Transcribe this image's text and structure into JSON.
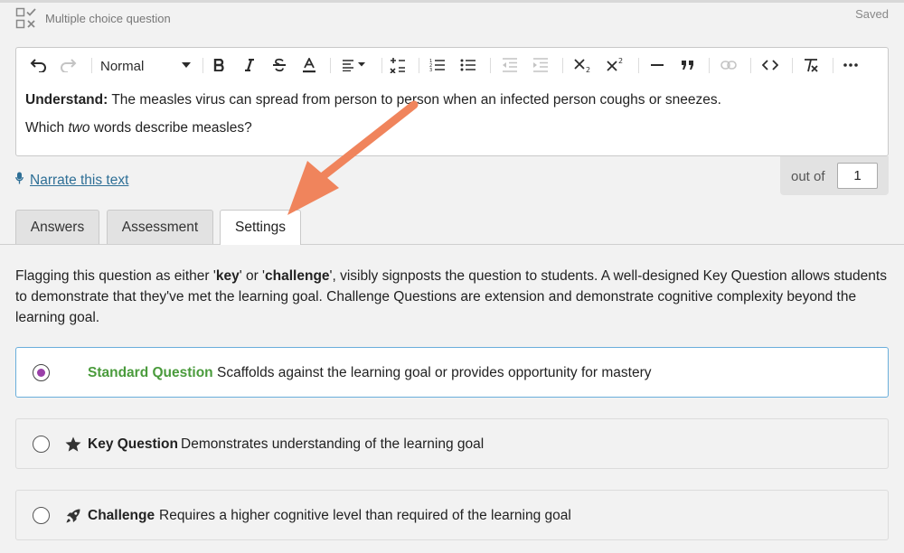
{
  "header": {
    "question_type": "Multiple choice question",
    "status": "Saved"
  },
  "editor": {
    "format_select_value": "Normal",
    "toolbar_icons": [
      "undo-icon",
      "redo-icon",
      "bold-icon",
      "italic-icon",
      "strikethrough-icon",
      "text-color-icon",
      "align-icon",
      "formula-icon",
      "ordered-list-icon",
      "bullet-list-icon",
      "outdent-icon",
      "indent-icon",
      "subscript-icon",
      "superscript-icon",
      "horizontal-rule-icon",
      "blockquote-icon",
      "link-icon",
      "code-icon",
      "clear-format-icon",
      "more-icon"
    ],
    "content": {
      "line1_bold": "Understand:",
      "line1_rest": " The measles virus can spread from person to person when an infected person coughs or sneezes.",
      "line2_pre": "Which ",
      "line2_italic": "two",
      "line2_post": " words describe measles?"
    }
  },
  "narrate": {
    "label": "Narrate this text"
  },
  "score": {
    "label": "out of",
    "value": "1"
  },
  "tabs": [
    {
      "label": "Answers",
      "active": false
    },
    {
      "label": "Assessment",
      "active": false
    },
    {
      "label": "Settings",
      "active": true
    }
  ],
  "settings": {
    "description": {
      "p1": "Flagging this question as either '",
      "key": "key",
      "p2": "' or '",
      "challenge": "challenge",
      "p3": "', visibly signposts the question to students. A well-designed Key Question allows students to demonstrate that they've met the learning goal. Challenge Questions are extension and demonstrate cognitive complexity beyond the learning goal."
    },
    "options": [
      {
        "title": "Standard Question",
        "description": "Scaffolds against the learning goal or provides opportunity for mastery",
        "selected": true,
        "icon": "none"
      },
      {
        "title": "Key Question",
        "description": "Demonstrates understanding of the learning goal",
        "selected": false,
        "icon": "star-icon"
      },
      {
        "title": "Challenge",
        "description": "Requires a higher cognitive level than required of the learning goal",
        "selected": false,
        "icon": "rocket-icon"
      }
    ]
  },
  "colors": {
    "accent_green": "#4a9b3c",
    "radio_selected": "#9a3fa8",
    "selected_border": "#6aaedb",
    "link_blue": "#2e6f96",
    "annotation_arrow": "#f0845c"
  }
}
